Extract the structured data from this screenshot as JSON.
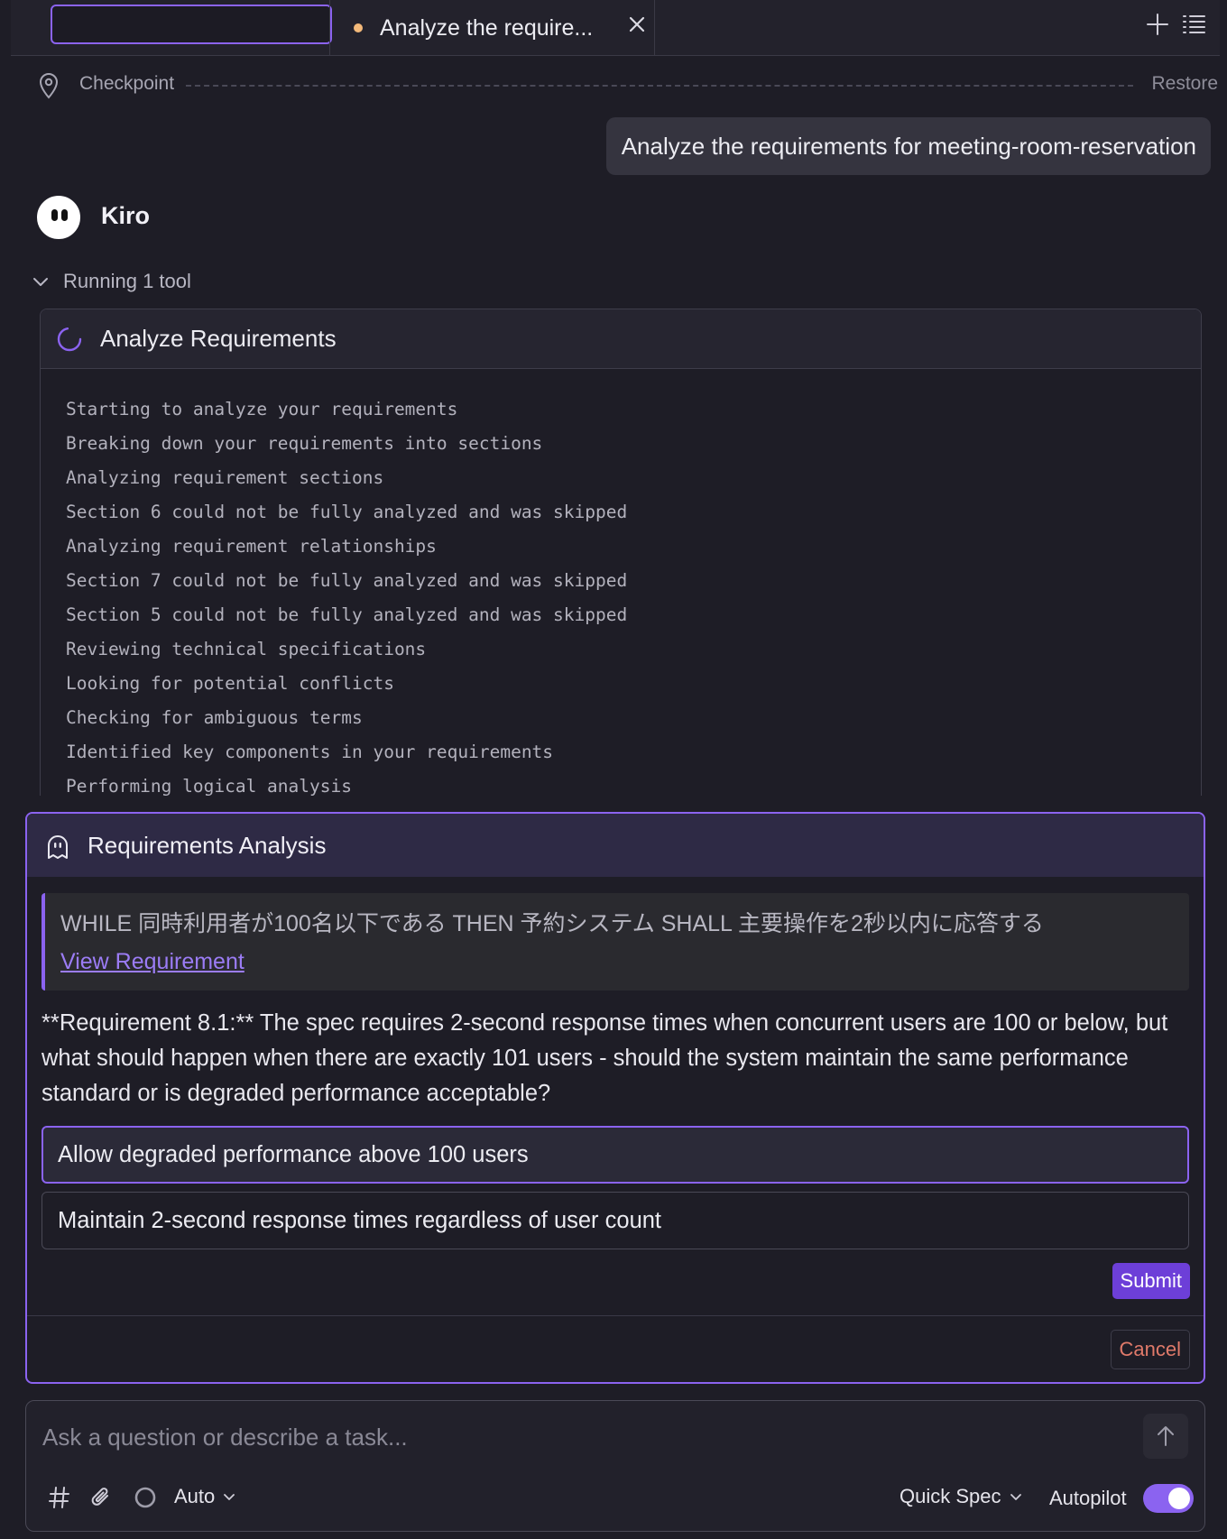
{
  "tabs": {
    "search_value": "",
    "active_title": "Analyze the require...",
    "close_icon": "close-icon",
    "new_tab_icon": "plus-icon",
    "list_icon": "list-icon"
  },
  "checkpoint": {
    "label": "Checkpoint",
    "restore_label": "Restore"
  },
  "user_message": "Analyze the requirements for meeting-room-reservation",
  "assistant": {
    "name": "Kiro"
  },
  "running": {
    "label": "Running 1 tool"
  },
  "tool": {
    "title": "Analyze Requirements",
    "log": [
      "Starting to analyze your requirements",
      "Breaking down your requirements into sections",
      "Analyzing requirement sections",
      "Section 6 could not be fully analyzed and was skipped",
      "Analyzing requirement relationships",
      "Section 7 could not be fully analyzed and was skipped",
      "Section 5 could not be fully analyzed and was skipped",
      "Reviewing technical specifications",
      "Looking for potential conflicts",
      "Checking for ambiguous terms",
      "Identified key components in your requirements",
      "Performing logical analysis"
    ]
  },
  "analysis": {
    "title": "Requirements Analysis",
    "quote": "WHILE 同時利用者が100名以下である THEN 予約システム SHALL 主要操作を2秒以内に応答する",
    "view_link": "View Requirement",
    "question": "**Requirement 8.1:** The spec requires 2-second response times when concurrent users are 100 or below, but what should happen when there are exactly 101 users - should the system maintain the same performance standard or is degraded performance acceptable?",
    "options": [
      "Allow degraded performance above 100 users",
      "Maintain 2-second response times regardless of user count"
    ],
    "selected_option": 0,
    "submit_label": "Submit",
    "cancel_label": "Cancel"
  },
  "composer": {
    "placeholder": "Ask a question or describe a task...",
    "mode": "Auto",
    "spec_mode": "Quick Spec",
    "autopilot_label": "Autopilot",
    "autopilot_on": true
  },
  "colors": {
    "accent": "#8b63f0",
    "background": "#1e1d26",
    "submit": "#6d3fd8",
    "cancel_text": "#e07a6a",
    "tab_dot": "#f3b97a"
  }
}
